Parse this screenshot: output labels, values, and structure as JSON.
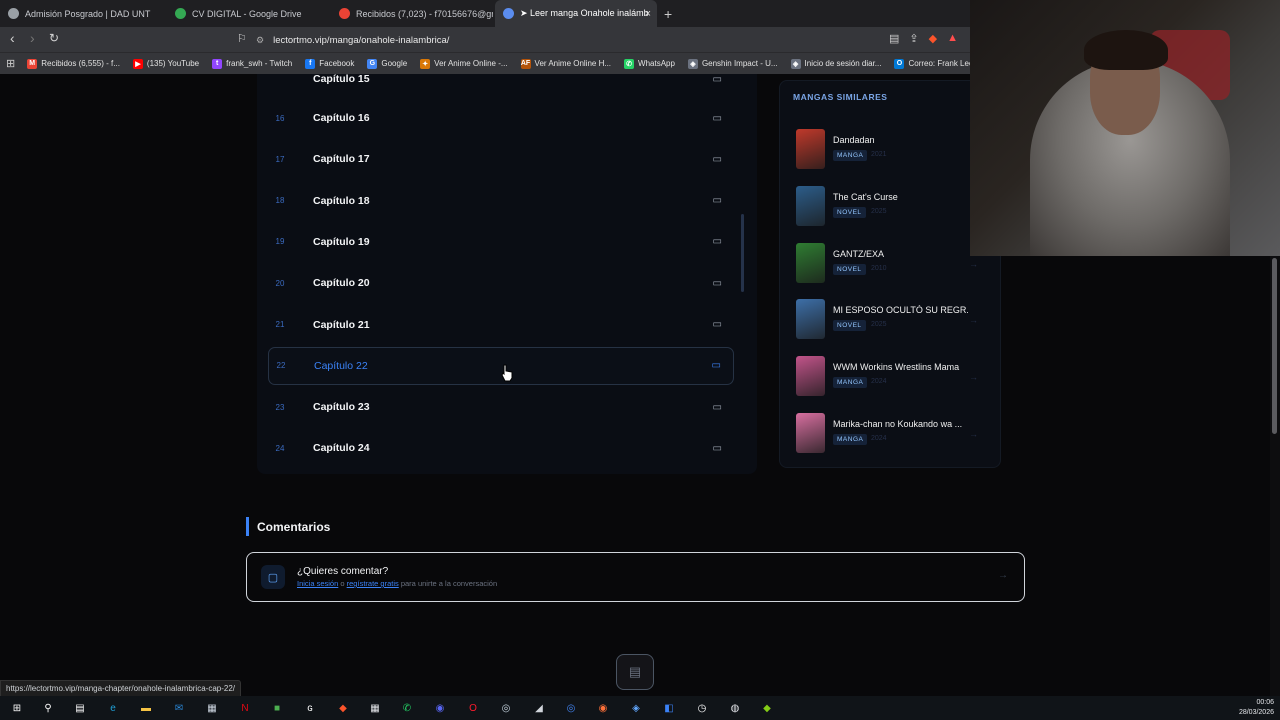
{
  "tabs": [
    {
      "label": "Admisión Posgrado | DAD UNT",
      "icon": "globe-icon",
      "color": "#9aa0a6"
    },
    {
      "label": "CV DIGITAL - Google Drive",
      "icon": "drive-icon",
      "color": "#34a853"
    },
    {
      "label": "Recibidos (7,023) - f70156676@gmai",
      "icon": "gmail-icon",
      "color": "#ea4335"
    },
    {
      "label": "➤ Leer manga Onahole inalámb",
      "icon": "page-icon",
      "color": "#5b8def"
    }
  ],
  "address": {
    "url": "lectortmo.vip/manga/onahole-inalambrica/"
  },
  "bookmarks": [
    {
      "label": "Recibidos (6,555) - f...",
      "icon": "gmail-icon",
      "color": "#ea4335",
      "glyph": "M"
    },
    {
      "label": "(135) YouTube",
      "icon": "youtube-icon",
      "color": "#ff0000",
      "glyph": "▶"
    },
    {
      "label": "frank_swh - Twitch",
      "icon": "twitch-icon",
      "color": "#9146ff",
      "glyph": "t"
    },
    {
      "label": "Facebook",
      "icon": "facebook-icon",
      "color": "#1877f2",
      "glyph": "f"
    },
    {
      "label": "Google",
      "icon": "google-icon",
      "color": "#4285f4",
      "glyph": "G"
    },
    {
      "label": "Ver Anime Online -...",
      "icon": "anime-icon",
      "color": "#d97706",
      "glyph": "✦"
    },
    {
      "label": "Ver Anime Online H...",
      "icon": "animeflv-icon",
      "color": "#b45309",
      "glyph": "AF"
    },
    {
      "label": "WhatsApp",
      "icon": "whatsapp-icon",
      "color": "#25d366",
      "glyph": "✆"
    },
    {
      "label": "Genshin Impact - U...",
      "icon": "genshin-icon",
      "color": "#6b7280",
      "glyph": "◈"
    },
    {
      "label": "Inicio de sesión diar...",
      "icon": "hoyolab-icon",
      "color": "#6b7280",
      "glyph": "◈"
    },
    {
      "label": "Correo: Frank Leo",
      "icon": "outlook-icon",
      "color": "#0078d4",
      "glyph": "O"
    }
  ],
  "chapters": [
    {
      "num": "16",
      "name": "Capítulo 16",
      "selected": false
    },
    {
      "num": "17",
      "name": "Capítulo 17",
      "selected": false
    },
    {
      "num": "18",
      "name": "Capítulo 18",
      "selected": false
    },
    {
      "num": "19",
      "name": "Capítulo 19",
      "selected": false
    },
    {
      "num": "20",
      "name": "Capítulo 20",
      "selected": false
    },
    {
      "num": "21",
      "name": "Capítulo 21",
      "selected": false
    },
    {
      "num": "22",
      "name": "Capítulo 22",
      "selected": true
    },
    {
      "num": "23",
      "name": "Capítulo 23",
      "selected": false
    },
    {
      "num": "24",
      "name": "Capítulo 24",
      "selected": false
    }
  ],
  "partial_chapter": {
    "name": "Capítulo 15"
  },
  "similar": {
    "heading": "MANGAS SIMILARES",
    "items": [
      {
        "title": "Dandadan",
        "type": "MANGA",
        "year": "2021",
        "color": "#c0392b"
      },
      {
        "title": "The Cat's Curse",
        "type": "NOVEL",
        "year": "2025",
        "color": "#2c5d8a"
      },
      {
        "title": "GANTZ/EXA",
        "type": "NOVEL",
        "year": "2010",
        "color": "#2f7d32"
      },
      {
        "title": "MI ESPOSO OCULTÓ SU REGR...",
        "type": "NOVEL",
        "year": "2025",
        "color": "#3d6fa8"
      },
      {
        "title": "WWM Workins Wrestlins Mama",
        "type": "MANGA",
        "year": "2024",
        "color": "#c2548a"
      },
      {
        "title": "Marika-chan no Koukando wa ...",
        "type": "MANGA",
        "year": "2024",
        "color": "#d86fa0"
      }
    ]
  },
  "comments": {
    "heading": "Comentarios",
    "question": "¿Quieres comentar?",
    "login": "Inicia sesión",
    "or": "o",
    "register": "regístrate gratis",
    "tail": "para unirte a la conversación"
  },
  "status_url": "https://lectortmo.vip/manga-chapter/onahole-inalambrica-cap-22/",
  "clock": {
    "time": "00:06",
    "date": "28/03/2026"
  },
  "taskbar_apps": [
    {
      "icon": "windows-start-icon",
      "glyph": "⊞",
      "color": "#ffffff"
    },
    {
      "icon": "search-icon",
      "glyph": "⚲",
      "color": "#ffffff"
    },
    {
      "icon": "task-view-icon",
      "glyph": "▤",
      "color": "#ffffff"
    },
    {
      "icon": "edge-icon",
      "glyph": "e",
      "color": "#1fa1d8"
    },
    {
      "icon": "file-explorer-icon",
      "glyph": "▬",
      "color": "#f5c344"
    },
    {
      "icon": "mail-icon",
      "glyph": "✉",
      "color": "#2b88d8"
    },
    {
      "icon": "store-icon",
      "glyph": "▦",
      "color": "#cfd8e3"
    },
    {
      "icon": "netflix-icon",
      "glyph": "N",
      "color": "#e50914"
    },
    {
      "icon": "minecraft-icon",
      "glyph": "■",
      "color": "#4caf50"
    },
    {
      "icon": "epic-icon",
      "glyph": "ɢ",
      "color": "#ffffff"
    },
    {
      "icon": "brave-icon",
      "glyph": "◆",
      "color": "#fb542b"
    },
    {
      "icon": "calculator-icon",
      "glyph": "▦",
      "color": "#e5e7eb"
    },
    {
      "icon": "whatsapp-icon",
      "glyph": "✆",
      "color": "#25d366"
    },
    {
      "icon": "discord-icon",
      "glyph": "◉",
      "color": "#5865f2"
    },
    {
      "icon": "opera-icon",
      "glyph": "O",
      "color": "#ff1b2d"
    },
    {
      "icon": "steam-icon",
      "glyph": "◎",
      "color": "#c7d5e0"
    },
    {
      "icon": "valorant-icon",
      "glyph": "◢",
      "color": "#d1d5db"
    },
    {
      "icon": "chrome-icon",
      "glyph": "◎",
      "color": "#4285f4"
    },
    {
      "icon": "firefox-icon",
      "glyph": "◉",
      "color": "#ff7139"
    },
    {
      "icon": "unknown-app-icon",
      "glyph": "◈",
      "color": "#60a5fa"
    },
    {
      "icon": "roblox-studio-icon",
      "glyph": "◧",
      "color": "#3b82f6"
    },
    {
      "icon": "clock-app-icon",
      "glyph": "◷",
      "color": "#ffffff"
    },
    {
      "icon": "obs-icon",
      "glyph": "◍",
      "color": "#e5e7eb"
    },
    {
      "icon": "bluestacks-icon",
      "glyph": "◆",
      "color": "#84cc16"
    }
  ]
}
